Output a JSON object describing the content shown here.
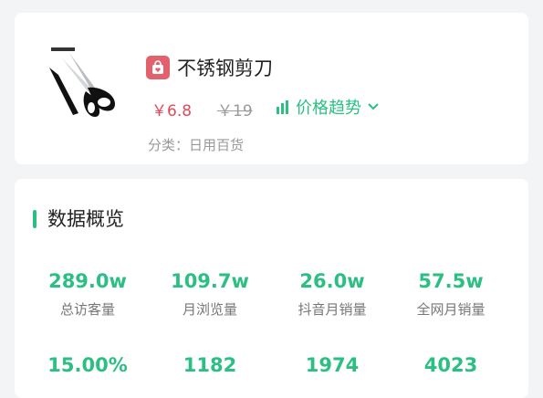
{
  "product": {
    "name": "不锈钢剪刀",
    "price": "￥6.8",
    "original_price": "￥19",
    "trend_label": "价格趋势",
    "category": "分类：日用百货",
    "shop_icon": "shopping-bag-icon",
    "accent_color": "#2bbf83",
    "price_color": "#e0495a"
  },
  "overview": {
    "title": "数据概览",
    "stats_row1": [
      {
        "value": "289.0w",
        "label": "总访客量"
      },
      {
        "value": "109.7w",
        "label": "月浏览量"
      },
      {
        "value": "26.0w",
        "label": "抖音月销量"
      },
      {
        "value": "57.5w",
        "label": "全网月销量"
      }
    ],
    "stats_row2": [
      {
        "value": "15.00%"
      },
      {
        "value": "1182"
      },
      {
        "value": "1974"
      },
      {
        "value": "4023"
      }
    ]
  }
}
